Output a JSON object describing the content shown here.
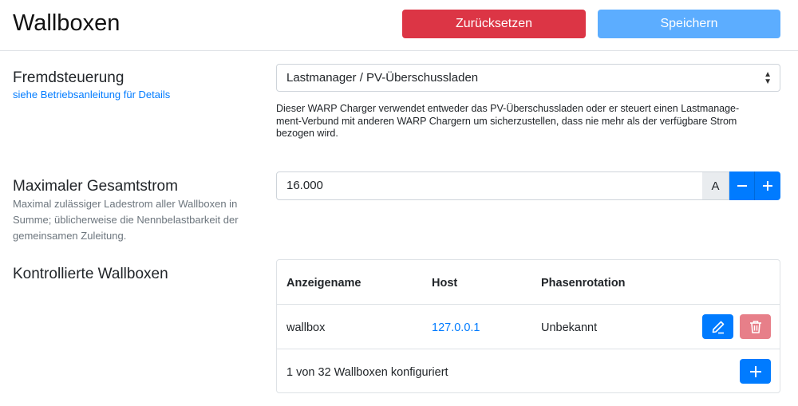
{
  "header": {
    "title": "Wallboxen",
    "reset_label": "Zurücksetzen",
    "save_label": "Speichern"
  },
  "fremdsteuerung": {
    "title": "Fremdsteuerung",
    "link": "siehe Betriebsanleitung für Details",
    "selected": "Lastmanager / PV-Überschussladen",
    "description_lines": [
      "Dieser WARP Charger verwendet entweder das PV-Überschussladen oder er steuert einen Lastmanage-",
      "ment-Verbund mit anderen WARP Chargern um sicherzustellen, dass nie mehr als der verfügbare Strom",
      "bezogen wird."
    ]
  },
  "gesamtstrom": {
    "title": "Maximaler Gesamtstrom",
    "help_lines": [
      "Maximal zulässiger Ladestrom aller Wallboxen in",
      "Summe; üblicherweise die Nennbelastbarkeit der",
      "gemeinsamen Zuleitung."
    ],
    "value": "16.000",
    "unit": "A"
  },
  "wallboxen": {
    "title": "Kontrollierte Wallboxen",
    "columns": [
      "Anzeigename",
      "Host",
      "Phasenrotation"
    ],
    "rows": [
      {
        "name": "wallbox",
        "host": "127.0.0.1",
        "rotation": "Unbekannt"
      }
    ],
    "footer": "1 von 32 Wallboxen konfiguriert"
  },
  "colors": {
    "danger": "#dc3545",
    "primary": "#007bff",
    "primary_light": "#5cadff",
    "danger_light": "#e77f89"
  }
}
